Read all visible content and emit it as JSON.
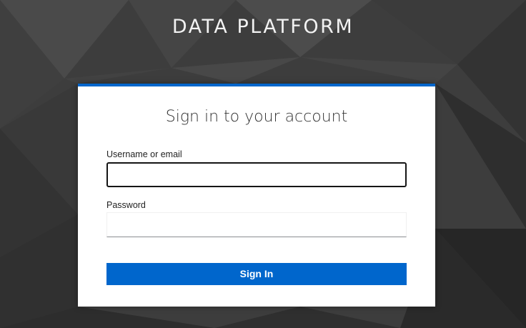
{
  "brand": {
    "title": "DATA PLATFORM"
  },
  "login": {
    "heading": "Sign in to your account",
    "username": {
      "label": "Username or email",
      "value": "",
      "placeholder": ""
    },
    "password": {
      "label": "Password",
      "value": "",
      "placeholder": ""
    },
    "submit_label": "Sign In"
  },
  "colors": {
    "accent": "#0066cc",
    "background": "#3a3a3a",
    "card": "#ffffff"
  }
}
